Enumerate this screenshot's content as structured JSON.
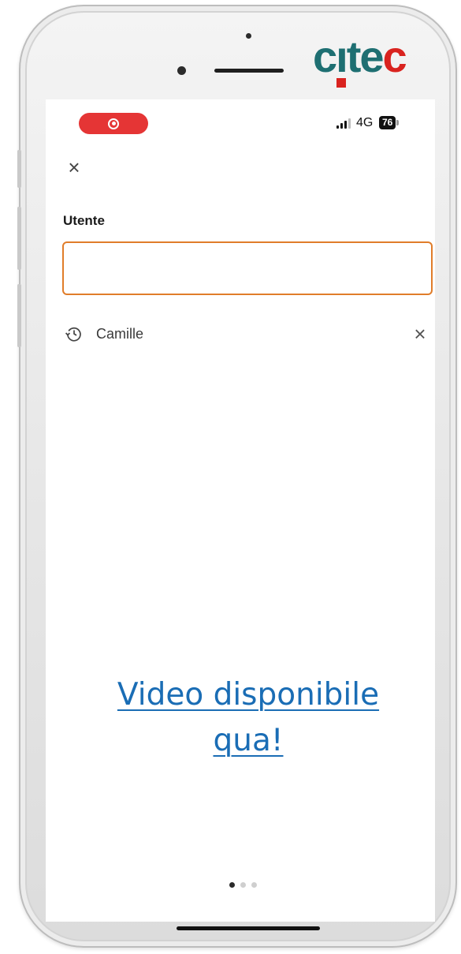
{
  "brand": {
    "logo_text_before": "c",
    "logo_i": "ı",
    "logo_text_middle": "te",
    "logo_text_end": "c",
    "colors": {
      "teal": "#1e6f72",
      "red": "#d9231f"
    }
  },
  "status_bar": {
    "recording_color": "#e53535",
    "network": "4G",
    "battery": "76"
  },
  "form": {
    "close_icon": "×",
    "label": "Utente",
    "input_value": "",
    "input_border_color": "#e07d2a"
  },
  "history": [
    {
      "icon": "history-icon",
      "name": "Camille",
      "remove_icon": "×"
    }
  ],
  "video_link": {
    "text_line1": "Video disponibile",
    "text_line2": "qua!",
    "color": "#1a6db5"
  },
  "pager": {
    "pages": 3,
    "active": 0
  }
}
